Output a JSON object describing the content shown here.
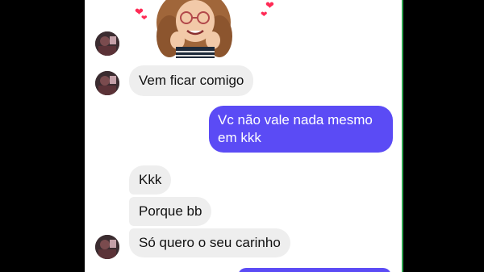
{
  "colors": {
    "incoming_bubble": "#eeeeee",
    "outgoing_bubble": "#5b4bf5",
    "heart": "#ff2a55"
  },
  "sticker": {
    "icon": "memoji-sticker-with-hearts"
  },
  "messages": [
    {
      "direction": "incoming",
      "text": "Vem ficar comigo"
    },
    {
      "direction": "outgoing",
      "text": "Vc não vale nada mesmo em kkk"
    },
    {
      "direction": "incoming",
      "text": "Kkk"
    },
    {
      "direction": "incoming",
      "text": "Porque bb"
    },
    {
      "direction": "incoming",
      "text": "Só quero o seu carinho"
    }
  ]
}
